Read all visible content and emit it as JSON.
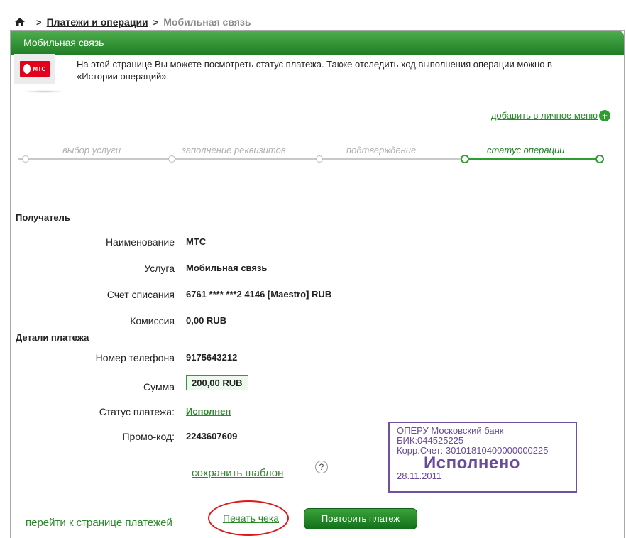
{
  "breadcrumb": {
    "items": [
      "Платежи и операции",
      "Мобильная связь"
    ],
    "separator": ">"
  },
  "panel": {
    "title": "Мобильная связь"
  },
  "intro": {
    "logo_text": "МТС",
    "text": "На этой странице Вы можете посмотреть статус платежа. Также отследить ход выполнения операции можно в «Истории операций»."
  },
  "add_menu": {
    "label": "добавить в личное меню",
    "icon": "plus-circle-icon"
  },
  "steps": [
    {
      "label": "выбор услуги",
      "state": "done"
    },
    {
      "label": "заполнение реквизитов",
      "state": "done"
    },
    {
      "label": "подтверждение",
      "state": "done"
    },
    {
      "label": "статус операции",
      "state": "active"
    }
  ],
  "recipient": {
    "title": "Получатель",
    "rows": [
      {
        "label": "Наименование",
        "value": "МТС"
      },
      {
        "label": "Услуга",
        "value": "Мобильная связь"
      },
      {
        "label": "Счет списания",
        "value": "6761 **** ***2 4146  [Maestro]  RUB"
      },
      {
        "label": "Комиссия",
        "value": "0,00 RUB"
      }
    ]
  },
  "payment": {
    "title": "Детали платежа",
    "rows": [
      {
        "label": "Номер телефона",
        "value": "9175643212"
      },
      {
        "label": "Сумма",
        "value": "200,00 RUB"
      },
      {
        "label": "Статус платежа:",
        "value": "Исполнен"
      },
      {
        "label": "Промо-код:",
        "value": "2243607609"
      }
    ]
  },
  "stamp": {
    "line1": "ОПЕРУ Московский банк",
    "line2": "БИК:044525225",
    "line3": "Корр.Счет: 30101810400000000225",
    "status": "Исполнено",
    "date": "28.11.2011"
  },
  "actions": {
    "save_template": "сохранить шаблон",
    "help": "?",
    "goto_payments": "перейти к странице платежей",
    "print_check": "Печать чека",
    "repeat": "Повторить платеж"
  },
  "colors": {
    "accent": "#2f9d2f",
    "header": "#1f7d24",
    "stamp": "#6a4a9c",
    "highlight": "#e11818"
  }
}
